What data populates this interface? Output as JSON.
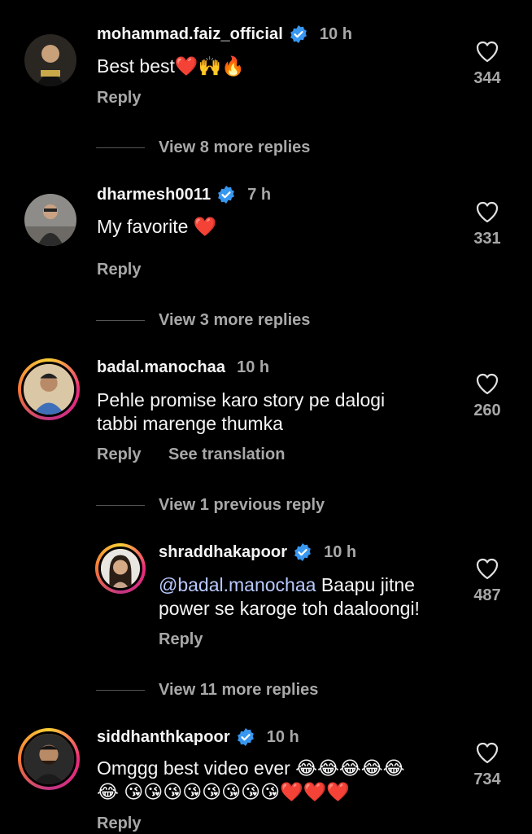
{
  "comments": [
    {
      "username": "mohammad.faiz_official",
      "verified": true,
      "time": "10 h",
      "text": "Best best❤️🙌🔥",
      "likes": "344",
      "reply_label": "Reply",
      "view_replies": "View 8 more replies"
    },
    {
      "username": "dharmesh0011",
      "verified": true,
      "time": "7 h",
      "text": "My favorite ❤️",
      "likes": "331",
      "reply_label": "Reply",
      "view_replies": "View 3 more replies"
    },
    {
      "username": "badal.manochaa",
      "verified": false,
      "time": "10 h",
      "text_line1": "Pehle promise karo story pe dalogi",
      "text_line2": "tabbi marenge thumka",
      "likes": "260",
      "reply_label": "Reply",
      "translate_label": "See translation",
      "view_previous": "View 1 previous reply"
    },
    {
      "username": "shraddhakapoor",
      "verified": true,
      "time": "10 h",
      "mention": "@badal.manochaa",
      "text_line1": " Baapu jitne",
      "text_line2": "power se karoge toh daaloongi!",
      "likes": "487",
      "reply_label": "Reply",
      "view_replies": "View 11 more replies"
    },
    {
      "username": "siddhanthkapoor",
      "verified": true,
      "time": "10 h",
      "text_line1": "Omggg best video ever 😂😂😂😂😂",
      "text_line2": "😂 😘😘😘😘😘😘😘😘❤️❤️❤️",
      "likes": "734",
      "reply_label": "Reply"
    }
  ],
  "icons": {
    "heart": "heart-outline-icon",
    "verified": "verified-badge-icon"
  },
  "colors": {
    "background": "#000000",
    "verified_blue": "#3897f0",
    "secondary_text": "#a8a8a8",
    "mention": "#b9c9ff"
  }
}
